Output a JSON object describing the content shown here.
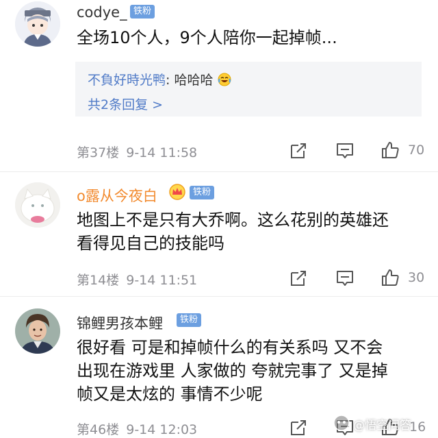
{
  "comments": [
    {
      "username": "codye_",
      "badge": "铁粉",
      "text": "全场10个人，9个人陪你一起掉帧...",
      "reply": {
        "user": "不負好時光鸭",
        "colon": ": ",
        "text": "哈哈哈",
        "emoji": "laughing-crying-emoji",
        "count_label": "共2条回复 >"
      },
      "floor": "第37楼",
      "time": "9-14 11:58",
      "likes": "70"
    },
    {
      "username": "o露从今夜白",
      "badge": "铁粉",
      "text_lines": [
        "地图上不是只有大乔啊。这么花别的英雄还",
        "看得见自己的技能吗"
      ],
      "floor": "第14楼",
      "time": "9-14 11:51",
      "likes": "30"
    },
    {
      "username": "锦鲤男孩本鲤",
      "badge": "铁粉",
      "text_lines": [
        "很好看 可是和掉帧什么的有关系吗 又不会",
        "出现在游戏里 人家做的 夸就完事了 又是掉",
        "帧又是太炫的 事情不少呢"
      ],
      "floor": "第46楼",
      "time": "9-14 12:03",
      "likes": "16"
    }
  ],
  "watermark": "@悟空问答",
  "colors": {
    "reply_blue": "#4f7ac7",
    "badge_blue": "#6c9fe0",
    "vip_orange": "#f28a2e",
    "meta_gray": "#8e8e93"
  }
}
